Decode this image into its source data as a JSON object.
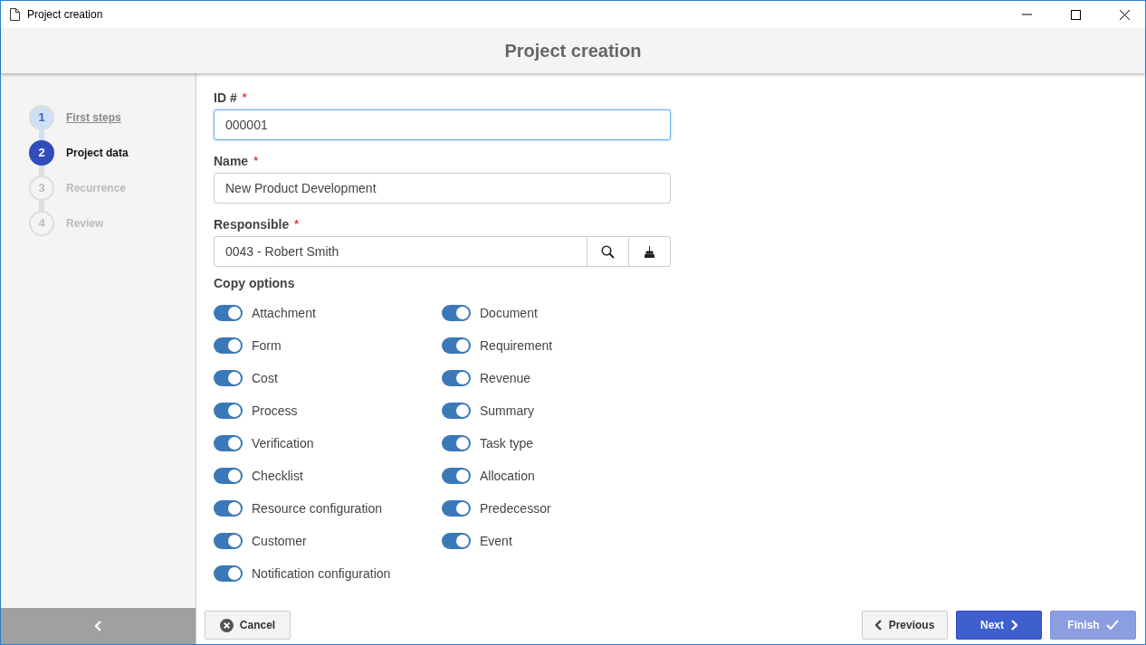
{
  "window": {
    "title": "Project creation"
  },
  "header": {
    "title": "Project creation"
  },
  "steps": [
    {
      "number": "1",
      "label": "First steps",
      "completed": true,
      "selected": false
    },
    {
      "number": "2",
      "label": "Project data",
      "completed": false,
      "selected": true
    },
    {
      "number": "3",
      "label": "Recurrence",
      "completed": false,
      "selected": false
    },
    {
      "number": "4",
      "label": "Review",
      "completed": false,
      "selected": false
    }
  ],
  "fields": [
    {
      "kind": "text",
      "label": "ID #",
      "required_mark": "*",
      "value": "000001",
      "focused": true
    },
    {
      "kind": "text",
      "label": "Name",
      "required_mark": "*",
      "value": "New Product Development",
      "focused": false
    },
    {
      "kind": "lookup",
      "label": "Responsible",
      "required_mark": "*",
      "value": "0043 - Robert Smith",
      "focused": false
    }
  ],
  "copy_options": {
    "title": "Copy options",
    "items": [
      {
        "label": "Attachment",
        "on": true
      },
      {
        "label": "Document",
        "on": true
      },
      {
        "label": "Form",
        "on": true
      },
      {
        "label": "Requirement",
        "on": true
      },
      {
        "label": "Cost",
        "on": true
      },
      {
        "label": "Revenue",
        "on": true
      },
      {
        "label": "Process",
        "on": true
      },
      {
        "label": "Summary",
        "on": true
      },
      {
        "label": "Verification",
        "on": true
      },
      {
        "label": "Task type",
        "on": true
      },
      {
        "label": "Checklist",
        "on": true
      },
      {
        "label": "Allocation",
        "on": true
      },
      {
        "label": "Resource configuration",
        "on": true
      },
      {
        "label": "Predecessor",
        "on": true
      },
      {
        "label": "Customer",
        "on": true
      },
      {
        "label": "Event",
        "on": true
      },
      {
        "label": "Notification configuration",
        "on": true
      }
    ]
  },
  "buttons": [
    {
      "kind": "cancel",
      "label": "Cancel",
      "disabled": false
    },
    {
      "kind": "previous",
      "label": "Previous",
      "disabled": false
    },
    {
      "kind": "next",
      "label": "Next",
      "disabled": false
    },
    {
      "kind": "finish",
      "label": "Finish",
      "disabled": true
    }
  ]
}
